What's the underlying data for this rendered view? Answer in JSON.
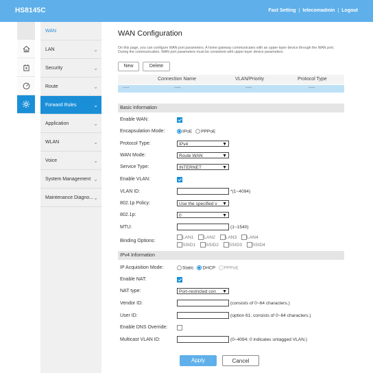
{
  "header": {
    "brand": "HS8145C",
    "links": [
      "Fast Setting",
      "telecomadmin",
      "Logout"
    ],
    "accent": "#5fb0ea"
  },
  "nav": {
    "top_label": "WAN",
    "items": [
      {
        "label": "LAN"
      },
      {
        "label": "Security"
      },
      {
        "label": "Route"
      },
      {
        "label": "Forward Rules"
      },
      {
        "label": "Application"
      },
      {
        "label": "WLAN"
      },
      {
        "label": "Voice"
      },
      {
        "label": "System Management"
      },
      {
        "label": "Maintenance Diagno..."
      }
    ],
    "icons": [
      "home-icon",
      "router-icon",
      "gauge-icon",
      "gear-icon"
    ]
  },
  "page": {
    "title": "WAN Configuration",
    "description": "On this page, you can configure WAN port parameters. A home gateway communicates with an upper-layer device through the WAN port. During the communication, WAN port parameters must be consistent with upper-layer device parameters.",
    "new_label": "New",
    "delete_label": "Delete"
  },
  "table": {
    "headers": [
      "Connection Name",
      "VLAN/Priority",
      "Protocol Type"
    ],
    "row": [
      "----",
      "----",
      "----",
      "----"
    ]
  },
  "basic": {
    "title": "Basic Information",
    "enable_wan": "Enable WAN:",
    "encap_label": "Encapsulation Mode:",
    "encap_opts": [
      "IPoE",
      "PPPoE"
    ],
    "protocol_label": "Protocol Type:",
    "protocol_value": "IPv4",
    "wan_mode_label": "WAN Mode:",
    "wan_mode_value": "Route WAN",
    "service_label": "Service Type:",
    "service_value": "INTERNET",
    "enable_vlan": "Enable VLAN:",
    "vlan_id_label": "VLAN ID:",
    "vlan_id_hint": "*(1~4094)",
    "policy_label": "802.1p Policy:",
    "policy_value": "Use the specified v",
    "p8021_label": "802.1p:",
    "p8021_value": "0",
    "mtu_label": "MTU:",
    "mtu_hint": "(1~1540)",
    "binding_label": "Binding Options:",
    "binding_row1": [
      "LAN1",
      "LAN2",
      "LAN3",
      "LAN4"
    ],
    "binding_row2": [
      "SSID1",
      "SSID2",
      "SSID3",
      "SSID4"
    ]
  },
  "ipv4": {
    "title": "IPv4 Information",
    "acq_label": "IP Acquisition Mode:",
    "acq_opts": [
      "Static",
      "DHCP",
      "PPPoE"
    ],
    "enable_nat": "Enable NAT:",
    "nat_type_label": "NAT type:",
    "nat_type_value": "Port-restricted con",
    "vendor_label": "Vendor ID:",
    "vendor_hint": "(consists of 0~64 characters.)",
    "user_label": "User ID:",
    "user_hint": "(option 61; consists of 0~64 characters.)",
    "dns_label": "Enable DNS Override:",
    "mvlan_label": "Multicast VLAN ID:",
    "mvlan_hint": "(0~4094; 0 indicates untagged VLAN.)"
  },
  "actions": {
    "apply": "Apply",
    "cancel": "Cancel"
  }
}
